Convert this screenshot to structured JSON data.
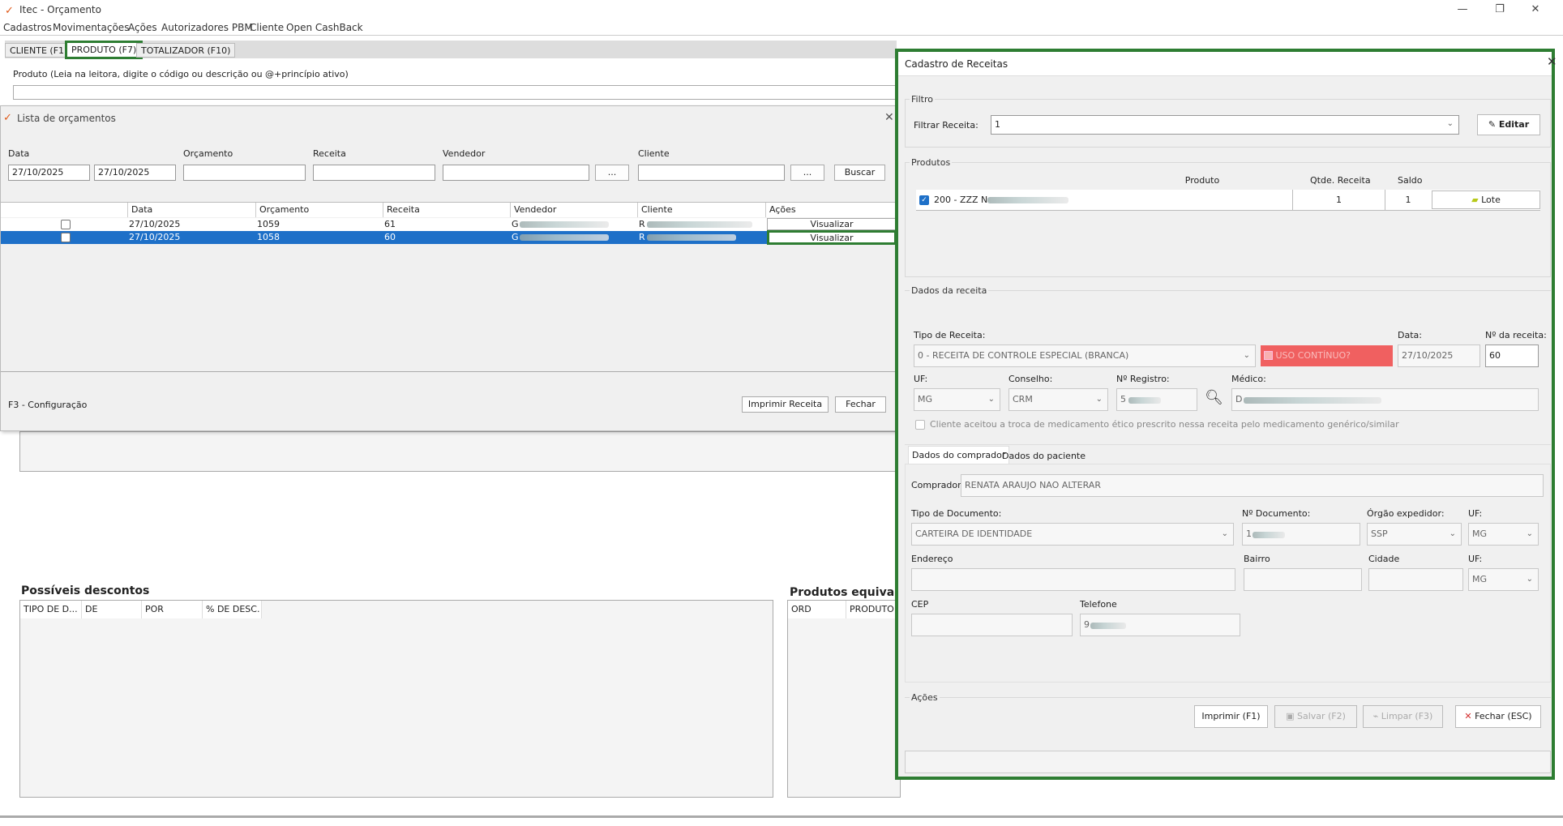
{
  "window": {
    "title": "Itec - Orçamento"
  },
  "menu": [
    "Cadastros",
    "Movimentações",
    "Ações",
    "Autorizadores PBM",
    "Cliente",
    "Open CashBack"
  ],
  "tabs": [
    "CLIENTE (F1)",
    "PRODUTO (F7)",
    "TOTALIZADOR (F10)"
  ],
  "produto_label": "Produto (Leia na leitora, digite o código ou descrição ou @+princípio ativo)",
  "lista": {
    "title": "Lista de orçamentos",
    "labels": {
      "data": "Data",
      "orcamento": "Orçamento",
      "receita": "Receita",
      "vendedor": "Vendedor",
      "cliente": "Cliente"
    },
    "data_de": "27/10/2025",
    "data_ate": "27/10/2025",
    "ellipsis": "...",
    "buscar": "Buscar",
    "columns": [
      "Data",
      "Orçamento",
      "Receita",
      "Vendedor",
      "Cliente",
      "Ações"
    ],
    "rows": [
      {
        "data": "27/10/2025",
        "orcamento": "1059",
        "receita": "61",
        "vendedor": "G",
        "cliente": "R",
        "acao": "Visualizar"
      },
      {
        "data": "27/10/2025",
        "orcamento": "1058",
        "receita": "60",
        "vendedor": "G",
        "cliente": "R",
        "acao": "Visualizar"
      }
    ],
    "footer_hint": "F3 - Configuração",
    "imprimir": "Imprimir Receita",
    "fechar": "Fechar"
  },
  "descontos": {
    "title": "Possíveis descontos",
    "columns": [
      "TIPO DE D...",
      "DE",
      "POR",
      "% DE DESC."
    ]
  },
  "equivalentes": {
    "title": "Produtos equivaler",
    "columns": [
      "ORD",
      "PRODUTO"
    ]
  },
  "dialog": {
    "title": "Cadastro de Receitas",
    "filtro": {
      "group": "Filtro",
      "label": "Filtrar Receita:",
      "value": "1",
      "editar": "Editar"
    },
    "produtos": {
      "group": "Produtos",
      "columns": [
        "Produto",
        "Qtde. Receita",
        "Saldo"
      ],
      "item": "200 - ZZZ N",
      "qtde": "1",
      "saldo": "1",
      "lote": "Lote"
    },
    "receita": {
      "group": "Dados da receita",
      "tipo_label": "Tipo de Receita:",
      "tipo_value": "0 - RECEITA DE CONTROLE ESPECIAL (BRANCA)",
      "uso_continuo": "USO CONTÍNUO?",
      "data_label": "Data:",
      "data_value": "27/10/2025",
      "numero_label": "Nº da receita:",
      "numero_value": "60",
      "uf_label": "UF:",
      "uf_value": "MG",
      "conselho_label": "Conselho:",
      "conselho_value": "CRM",
      "registro_label": "Nº Registro:",
      "registro_value": "5",
      "medico_label": "Médico:",
      "medico_value": "D",
      "generico": "Cliente aceitou a troca de medicamento ético prescrito nessa receita pelo medicamento genérico/similar"
    },
    "subtabs": [
      "Dados do comprador",
      "Dados do paciente"
    ],
    "comprador": {
      "label": "Comprador:",
      "value": "RENATA ARAUJO   NAO ALTERAR",
      "tipo_doc_label": "Tipo de Documento:",
      "tipo_doc_value": "CARTEIRA DE IDENTIDADE",
      "num_doc_label": "Nº Documento:",
      "num_doc_value": "1",
      "orgao_label": "Órgão expedidor:",
      "orgao_value": "SSP",
      "uf_label": "UF:",
      "uf_value": "MG",
      "endereco_label": "Endereço",
      "bairro_label": "Bairro",
      "cidade_label": "Cidade",
      "uf2_label": "UF:",
      "uf2_value": "MG",
      "cep_label": "CEP",
      "telefone_label": "Telefone",
      "telefone_value": "9"
    },
    "acoes": {
      "group": "Ações",
      "imprimir": "Imprimir (F1)",
      "salvar": "Salvar (F2)",
      "limpar": "Limpar (F3)",
      "fechar": "Fechar (ESC)"
    }
  },
  "colors": {
    "accent_green": "#2e7d32",
    "selection_blue": "#1e70c8",
    "uso_red": "#f06060"
  }
}
